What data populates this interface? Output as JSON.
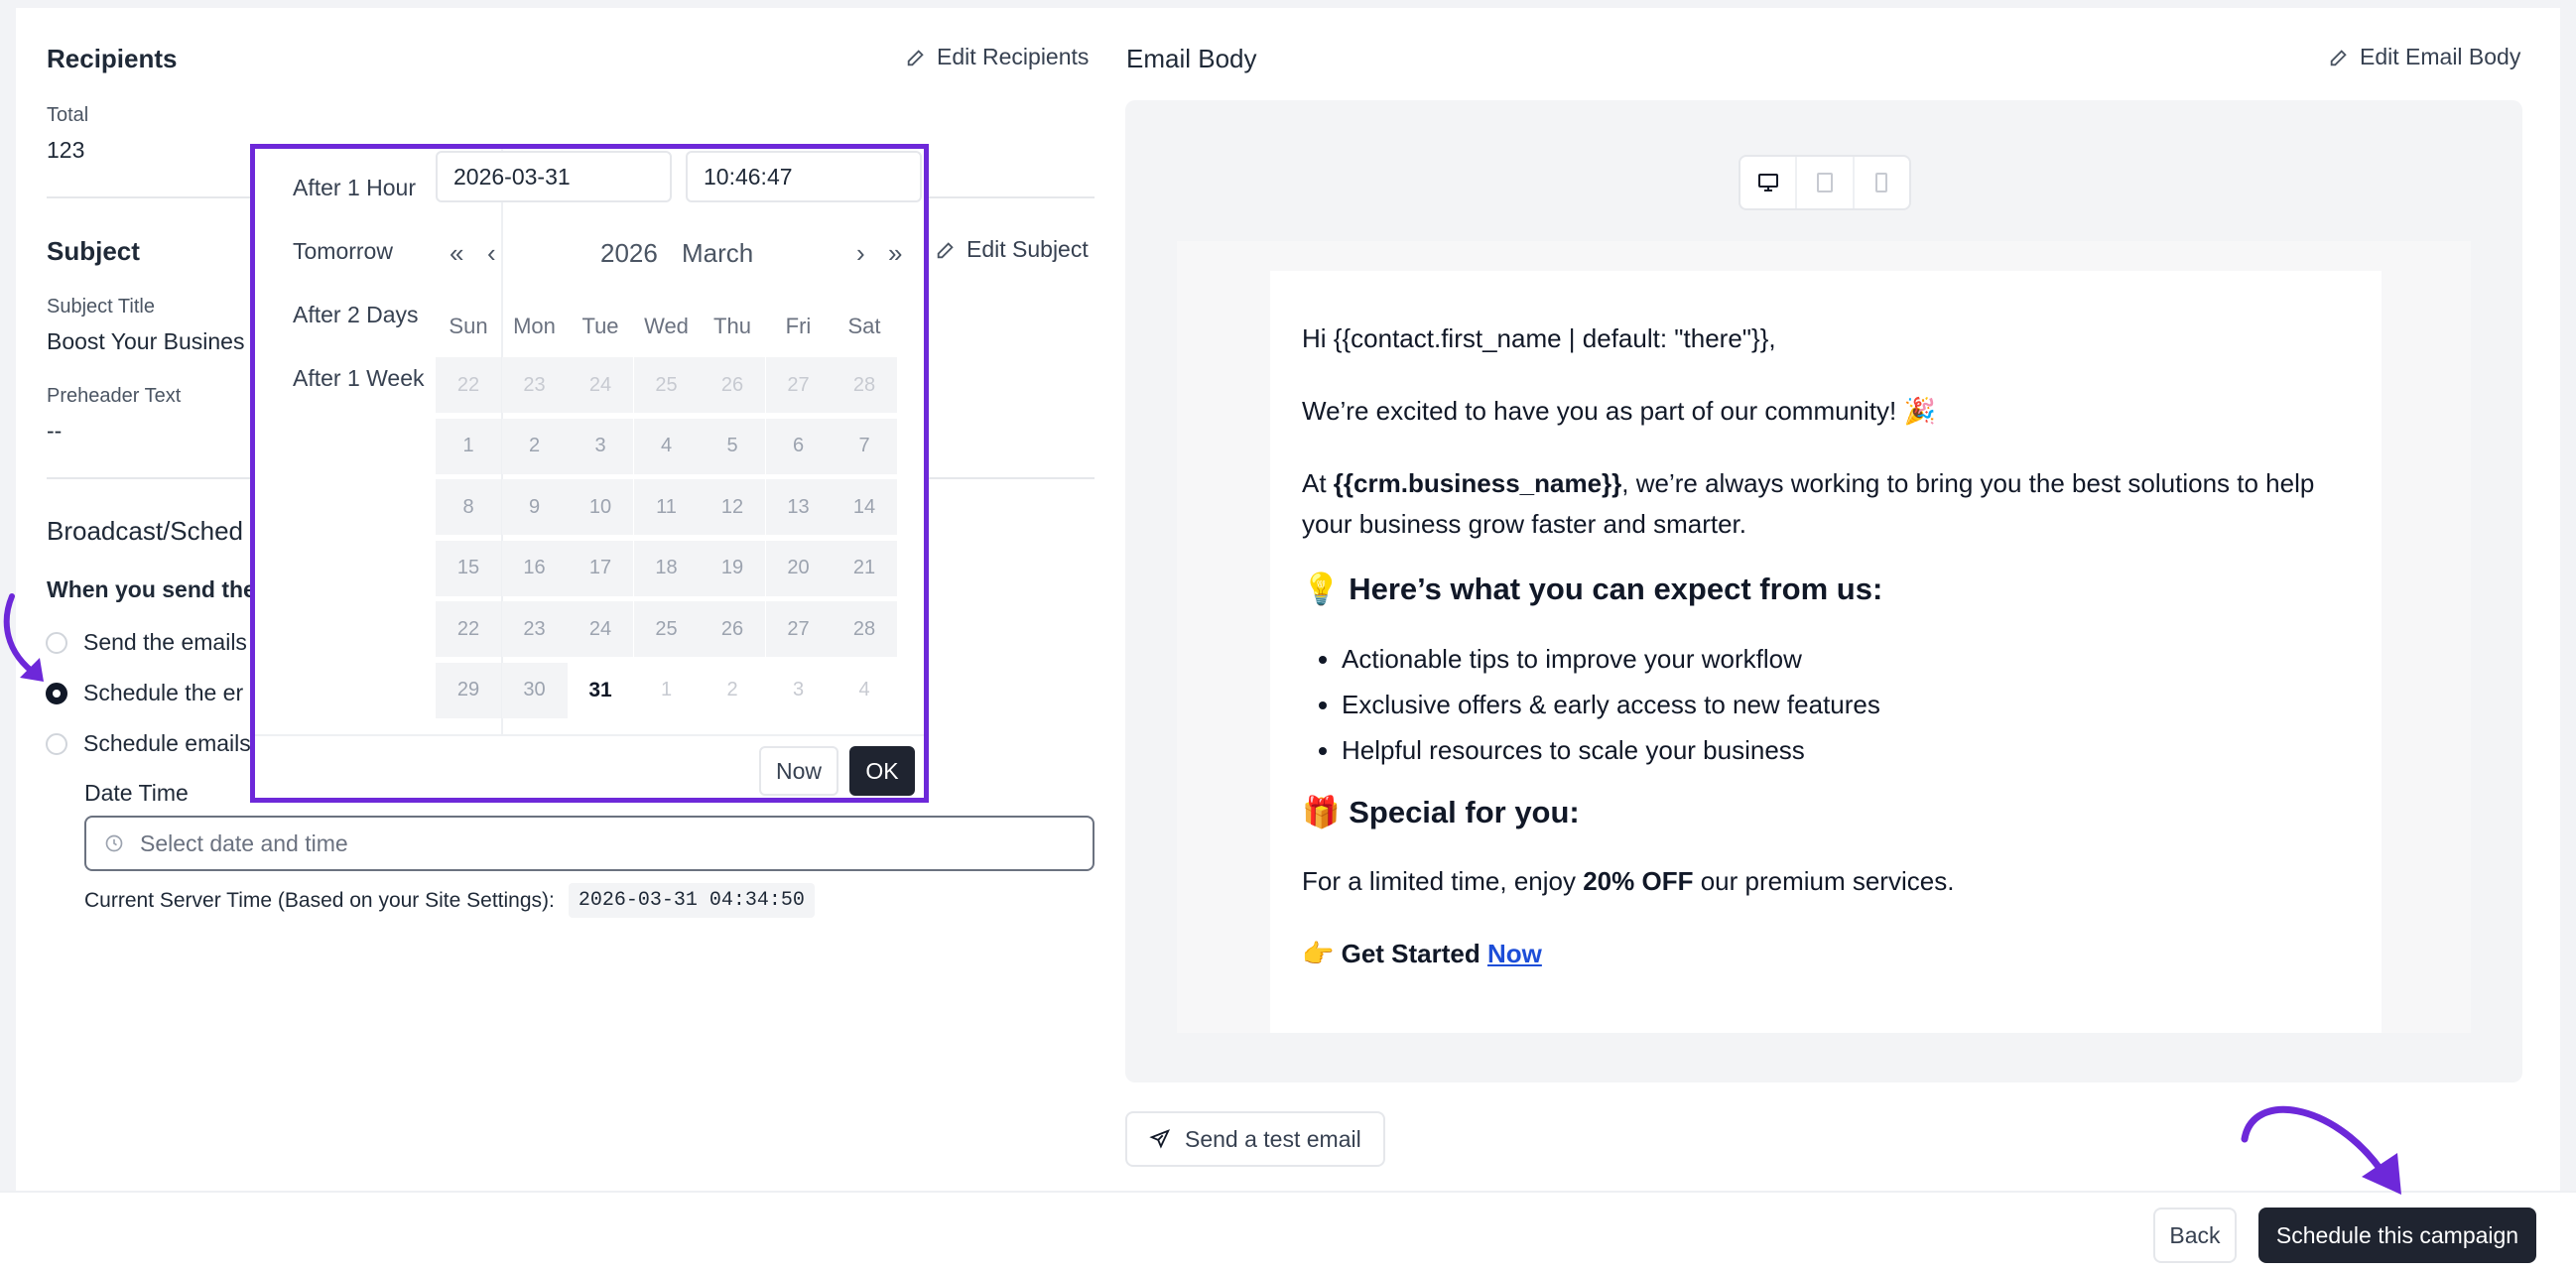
{
  "recipients": {
    "title": "Recipients",
    "edit_label": "Edit Recipients",
    "total_label": "Total",
    "total_value": "123"
  },
  "subject": {
    "title": "Subject",
    "edit_label": "Edit Subject",
    "subject_title_label": "Subject Title",
    "subject_title_value": "Boost Your Busines",
    "preheader_label": "Preheader Text",
    "preheader_value": "--"
  },
  "broadcast": {
    "title": "Broadcast/Sched",
    "question": "When you send the",
    "options": [
      {
        "label": "Send the emails",
        "selected": false
      },
      {
        "label": "Schedule the er",
        "selected": true
      },
      {
        "label": "Schedule emails",
        "selected": false
      }
    ],
    "datetime_label": "Date Time",
    "datetime_placeholder": "Select date and time",
    "server_time_label": "Current Server Time (Based on your Site Settings):",
    "server_time_value": "2026-03-31 04:34:50"
  },
  "picker": {
    "shortcuts": [
      "After 1 Hour",
      "Tomorrow",
      "After 2 Days",
      "After 1 Week"
    ],
    "date_value": "2026-03-31",
    "time_value": "10:46:47",
    "nav": {
      "prev_year": "«",
      "prev_month": "‹",
      "next_month": "›",
      "next_year": "»"
    },
    "year": "2026",
    "month": "March",
    "weekdays": [
      "Sun",
      "Mon",
      "Tue",
      "Wed",
      "Thu",
      "Fri",
      "Sat"
    ],
    "weeks": [
      [
        "22",
        "23",
        "24",
        "25",
        "26",
        "27",
        "28"
      ],
      [
        "1",
        "2",
        "3",
        "4",
        "5",
        "6",
        "7"
      ],
      [
        "8",
        "9",
        "10",
        "11",
        "12",
        "13",
        "14"
      ],
      [
        "15",
        "16",
        "17",
        "18",
        "19",
        "20",
        "21"
      ],
      [
        "22",
        "23",
        "24",
        "25",
        "26",
        "27",
        "28"
      ],
      [
        "29",
        "30",
        "31",
        "1",
        "2",
        "3",
        "4"
      ]
    ],
    "now_label": "Now",
    "ok_label": "OK"
  },
  "email_body": {
    "title": "Email Body",
    "edit_label": "Edit Email Body",
    "greeting": "Hi {{contact.first_name | default: \"there\"}},",
    "excited": "We’re excited to have you as part of our community! 🎉",
    "at_prefix": "At ",
    "business_tag": "{{crm.business_name}}",
    "at_suffix": ", we’re always working to bring you the best solutions to help your business grow faster and smarter.",
    "expect_heading": "💡 Here’s what you can expect from us:",
    "bullets": [
      "Actionable tips to improve your workflow",
      "Exclusive offers & early access to new features",
      "Helpful resources to scale your business"
    ],
    "special_heading": "🎁 Special for you:",
    "offer_prefix": "For a limited time, enjoy ",
    "offer_bold": "20% OFF",
    "offer_suffix": " our premium services.",
    "cta_prefix": "👉 Get Started ",
    "cta_link": "Now"
  },
  "test_email_label": "Send a test email",
  "footer": {
    "back_label": "Back",
    "schedule_label": "Schedule this campaign"
  },
  "colors": {
    "accent_purple": "#6d28d9",
    "primary_dark": "#1f2430"
  }
}
